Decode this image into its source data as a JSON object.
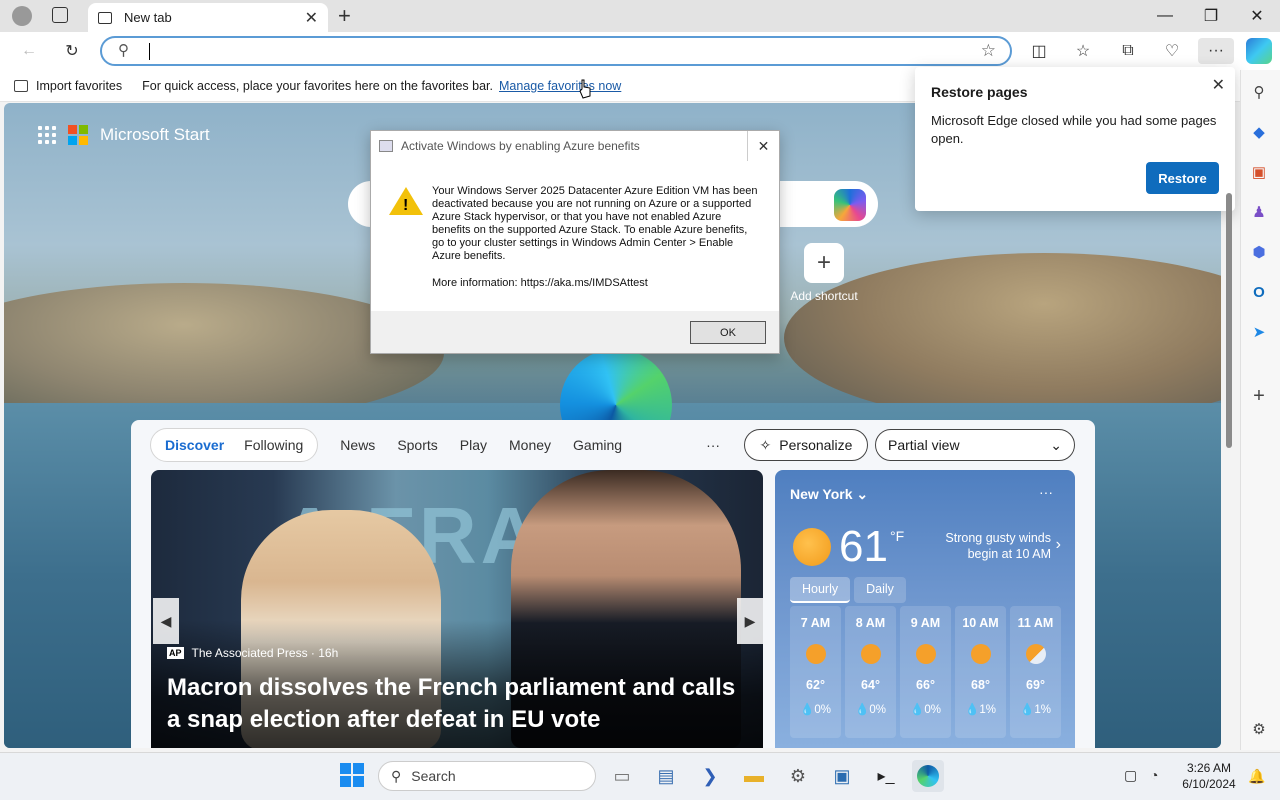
{
  "browser": {
    "tab_title": "New tab",
    "address_value": "",
    "favorites_bar": {
      "import_label": "Import favorites",
      "hint_text": "For quick access, place your favorites here on the favorites bar.",
      "manage_link": "Manage favorites now"
    }
  },
  "new_tab": {
    "brand": "Microsoft Start",
    "add_shortcut_label": "Add shortcut",
    "feed_tabs": [
      "Discover",
      "Following"
    ],
    "feed_links": [
      "News",
      "Sports",
      "Play",
      "Money",
      "Gaming"
    ],
    "more_label": "···",
    "personalize_label": "Personalize",
    "view_select": "Partial view"
  },
  "news_card": {
    "source": "The Associated Press · 16h",
    "source_badge": "AP",
    "headline": "Macron dissolves the French parliament and calls a snap election after defeat in EU vote",
    "bg_text": "A FRANC"
  },
  "weather": {
    "city": "New York",
    "temperature": "61",
    "unit": "°F",
    "alert": "Strong gusty winds begin at 10 AM",
    "tabs": [
      "Hourly",
      "Daily"
    ],
    "hours": [
      {
        "time": "7 AM",
        "temp": "62°",
        "precip": "💧0%"
      },
      {
        "time": "8 AM",
        "temp": "64°",
        "precip": "💧0%"
      },
      {
        "time": "9 AM",
        "temp": "66°",
        "precip": "💧0%"
      },
      {
        "time": "10 AM",
        "temp": "68°",
        "precip": "💧1%"
      },
      {
        "time": "11 AM",
        "temp": "69°",
        "precip": "💧1%"
      }
    ]
  },
  "dialog": {
    "title": "Activate Windows by enabling Azure benefits",
    "message": "Your Windows Server 2025 Datacenter Azure Edition VM has been deactivated because you are not running on Azure or a supported Azure Stack hypervisor, or that you have not enabled Azure benefits on the supported Azure Stack. To enable Azure benefits, go to your cluster settings in Windows Admin Center > Enable Azure benefits.",
    "info": "More information: https://aka.ms/IMDSAttest",
    "ok_label": "OK"
  },
  "restore_popup": {
    "title": "Restore pages",
    "text": "Microsoft Edge closed while you had some pages open.",
    "button": "Restore"
  },
  "taskbar": {
    "search_placeholder": "Search",
    "time": "3:26 AM",
    "date": "6/10/2024"
  },
  "colors": {
    "accent": "#0f6cbd",
    "link": "#1a5aa6",
    "feed_active": "#1a6cd0"
  }
}
